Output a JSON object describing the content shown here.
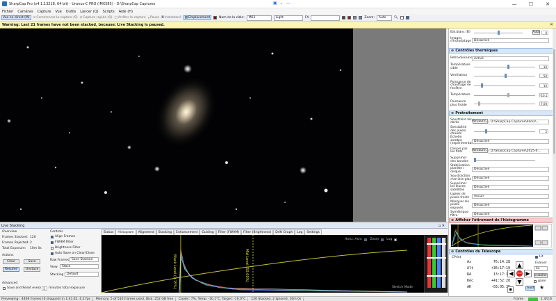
{
  "window": {
    "title": "SharpCap Pro (v4.1.13218, 64 bit) - Uranus-C PRO (IMX585) - D:\\SharpCap Captures",
    "minimize": "—",
    "maximize": "☐",
    "close": "✕"
  },
  "menu": [
    "Fichier",
    "Caméras",
    "Capture",
    "Vue",
    "Outils",
    "Lancer (Q)",
    "Scripts",
    "Aide (H)"
  ],
  "toolbar": {
    "live": "Vue en direct (M)",
    "start_capture": "Commencer la capture (S)",
    "quick_capture": "Capture rapide (Q)",
    "stop_capture": "Arrêter la capture",
    "pause": "Pause",
    "snapshot": "Instantané",
    "location": "Emplacement",
    "target_label": "Nom de la cible:",
    "target_value": "M63",
    "filter_value": "Light",
    "fx_label": "FX",
    "zoom_label": "Zoom:",
    "zoom_value": "Auto"
  },
  "warning": "Warning: Last 21 frames have not been stacked, because: Live Stacking is paused.",
  "right_panel": {
    "top_rows": [
      {
        "label": "Bal.blanc (B)",
        "value": "0",
        "button": "Auto"
      },
      {
        "label": "Images d'horodatage",
        "value": "Désactivé"
      }
    ],
    "thermal": {
      "title": "Contrôles thermiques",
      "rows": [
        {
          "label": "Refroidissement",
          "value": "Activé"
        },
        {
          "label": "Température cible",
          "value": "-10"
        },
        {
          "label": "Ventilateur",
          "value": "50"
        },
        {
          "label": "Puissance de chauffage de fenêtre",
          "value": "10"
        },
        {
          "label": "Température",
          "value": "-10.1"
        },
        {
          "label": "Puissance plus froide",
          "value": "7.00"
        }
      ]
    },
    "preprocess": {
      "title": "Prétraitement",
      "rows": [
        {
          "label": "Soustraire les darks",
          "button": "Parcourir...",
          "value": "D:\\SharpCap Captures\\darks\\..."
        },
        {
          "label": "Sensibilité des pixels chauds",
          "value": "5"
        },
        {
          "label": "Échelle sombre (expérimentale)",
          "value": "Désactivé"
        },
        {
          "label": "Diviser par les flats",
          "button": "Parcourir...",
          "value": "D:\\SharpCap Captures\\2025-0..."
        },
        {
          "label": "Supprimer des bandes",
          "value": ""
        },
        {
          "label": "Stabilisation planète / disque",
          "value": "Désactivé"
        },
        {
          "label": "Soustraction d'arrière-plan",
          "value": "Désactivé"
        },
        {
          "label": "Supprimer les traces satellites",
          "value": "Désactivé"
        },
        {
          "label": "Lignes de pixels froids",
          "value": "Aucun"
        },
        {
          "label": "Masquer les pixels exposés",
          "value": "Désactivé"
        },
        {
          "label": "Symétrique filtre",
          "value": "Désactivé"
        }
      ]
    },
    "histogram_section": {
      "title": "Afficher l'étirement de l'histogramme"
    },
    "telescope": {
      "title": "Contrôles du Télescope",
      "cprint": "CPrint",
      "coords": [
        {
          "label": "Az",
          "value": "76:14:28"
        },
        {
          "label": "Alt",
          "value": "+36:17:19"
        },
        {
          "label": "RA",
          "value": "13:17:18"
        },
        {
          "label": "Déc",
          "value": "+41:52:28"
        },
        {
          "label": "AH",
          "value": "-03:05:35"
        }
      ],
      "speed_label": "Évaluer",
      "speed_value": "4x",
      "install_button": "Installer",
      "park_label": "garer",
      "guide_button": "Guid",
      "lit_label": "Lit",
      "stop_label": "STOP"
    }
  },
  "live_stacking": {
    "title": "Live Stacking",
    "overview_title": "Overview",
    "frames_stacked_label": "Frames Stacked:",
    "frames_stacked": "120",
    "frames_rejected_label": "Frames Rejected:",
    "frames_rejected": "2",
    "total_exposure_label": "Total Exposure:",
    "total_exposure": "10m 0s",
    "actions_title": "Actions",
    "clear": "Clear",
    "save": "Save",
    "resume": "Resume",
    "unstack": "Unstack",
    "advanced_title": "Advanced",
    "save_reset_label": "Save and Reset every",
    "save_reset_value": "5",
    "save_reset_unit": "minutes total exposure",
    "controls_title": "Controls",
    "align": "Align Frames",
    "fwhm": "FWHM Filter",
    "brightness": "Brightness Filter",
    "autosave": "Auto Save on Clear/Close",
    "raw_frames_label": "Raw Frames",
    "raw_frames_value": "Save Stacked",
    "view_label": "View",
    "view_value": "Stack",
    "stacking_label": "Stacking",
    "stacking_value": "Default",
    "tabs": [
      "Status",
      "Histogram",
      "Alignment",
      "Stacking",
      "Enhancement",
      "Guiding",
      "Filter (FWHM)",
      "Filter (Brightness)",
      "Drift Graph",
      "Log",
      "Settings"
    ],
    "active_tab": "Histogram",
    "hist_top": "Horiz. Axis:",
    "hist_zoom": "Zoom",
    "hist_log": "Log",
    "black_level": "Black Level (9.15%)",
    "mid_level": "Mid Level (50.00%)",
    "stretch_mode": "Stretch Mode"
  },
  "statusbar": {
    "previewing": "Previewing : 4466 frames (0 dropped) in 1:41:41, 0.2 fps",
    "memory": "Memory: 5 of 510 frames used, Disk: 252 GB free",
    "cooler": "Cooler: 7%, Temp: -10.1°C, Target: -10.0°C",
    "stacked": "120 Stacked, 2 Ignored, 10m 0s",
    "frame_label": "Frame",
    "frame_value": "1.4/3.6"
  },
  "colors": {
    "accent": "#1f5fbf",
    "warning_bg": "#fbf4b6",
    "section_bg": "#d8e8f8",
    "stop": "#e02020"
  }
}
